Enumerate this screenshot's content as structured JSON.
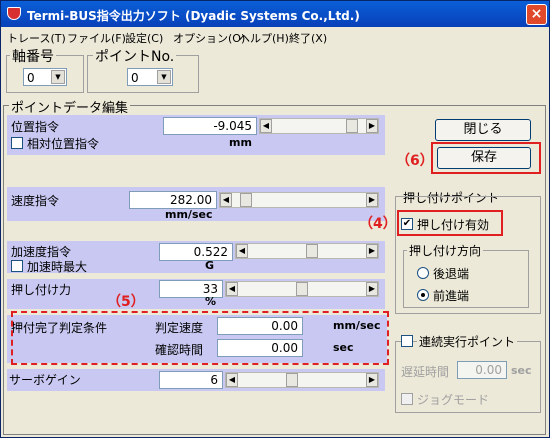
{
  "titlebar": {
    "title": "Termi-BUS指令出力ソフト (Dyadic Systems Co.,Ltd.)",
    "close": "×"
  },
  "menu": [
    "トレース(T)",
    "ファイル(F)",
    "設定(C)",
    "オプション(O)",
    "ヘルプ(H)",
    "終了(X)"
  ],
  "axis": {
    "label": "軸番号",
    "value": "0"
  },
  "point": {
    "label": "ポイントNo.",
    "value": "0"
  },
  "editor": {
    "title": "ポイントデータ編集",
    "position": {
      "label": "位置指令",
      "value": "-9.045",
      "unit": "mm",
      "relative_label": "相対位置指令",
      "relative_checked": false
    },
    "speed": {
      "label": "速度指令",
      "value": "282.00",
      "unit": "mm/sec"
    },
    "accel": {
      "label": "加速度指令",
      "value": "0.522",
      "unit": "G",
      "max_label": "加速時最大",
      "max_checked": false
    },
    "push_force": {
      "label": "押し付け力",
      "value": "33",
      "unit": "%"
    },
    "push_done": {
      "label": "押付完了判定条件",
      "judge_speed_label": "判定速度",
      "judge_speed_value": "0.00",
      "judge_speed_unit": "mm/sec",
      "confirm_time_label": "確認時間",
      "confirm_time_value": "0.00",
      "confirm_time_unit": "sec"
    },
    "servo_gain": {
      "label": "サーボゲイン",
      "value": "6"
    }
  },
  "buttons": {
    "close": "閉じる",
    "save": "保存"
  },
  "push_point": {
    "title": "押し付けポイント",
    "enable_label": "押し付け有効",
    "enable_checked": true,
    "direction": {
      "title": "押し付け方向",
      "options": [
        "後退端",
        "前進端"
      ],
      "selected": 1
    }
  },
  "continuous": {
    "label": "連続実行ポイント",
    "checked": false,
    "delay_label": "遅延時間",
    "delay_value": "0.00",
    "delay_unit": "sec",
    "jog_label": "ジョグモード",
    "jog_checked": false
  },
  "annotations": {
    "save_num": "（6）",
    "enable_num": "（4）",
    "push_done_num": "（5）"
  },
  "colors": {
    "accent": "#e02020",
    "panel": "#c8c8f2",
    "window": "#ece9d8",
    "title": "#0a5fd8"
  }
}
